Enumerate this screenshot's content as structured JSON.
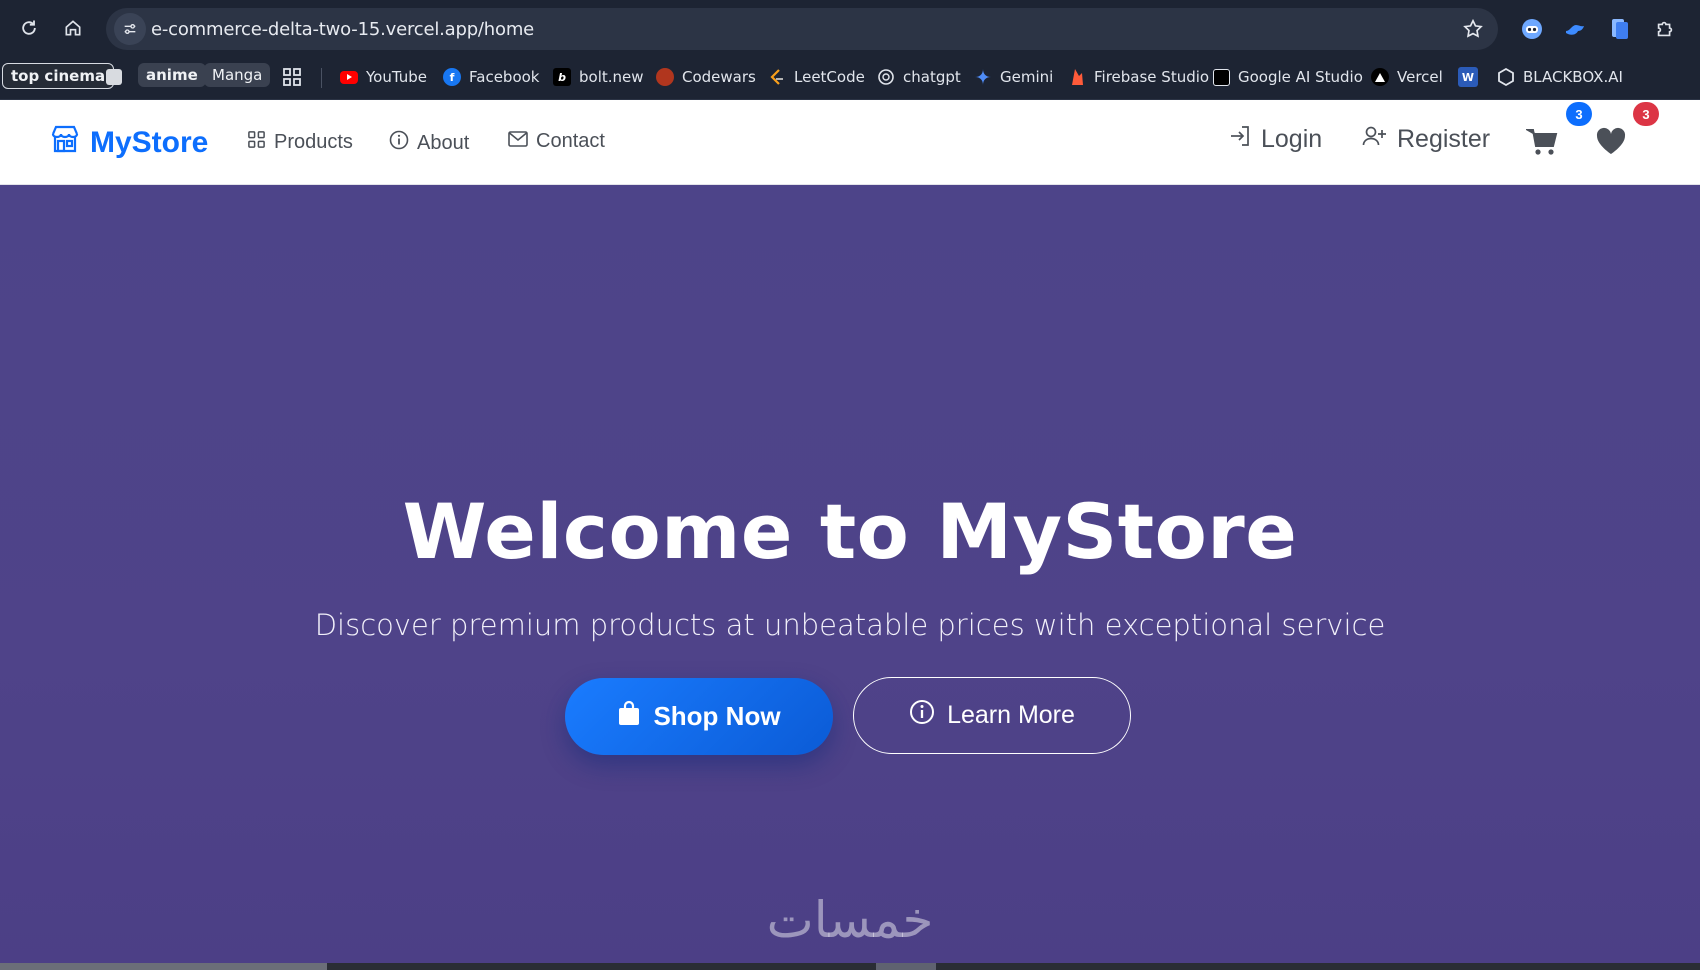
{
  "browser": {
    "url": "e-commerce-delta-two-15.vercel.app/home",
    "bookmarks": {
      "chips": [
        "top cinema",
        "anime",
        "Manga"
      ],
      "items": [
        "YouTube",
        "Facebook",
        "bolt.new",
        "Codewars",
        "LeetCode",
        "chatgpt",
        "Gemini",
        "Firebase Studio",
        "Google AI Studio",
        "Vercel",
        "BLACKBOX.AI"
      ]
    }
  },
  "site": {
    "brand": "MyStore",
    "nav": {
      "products": "Products",
      "about": "About",
      "contact": "Contact",
      "login": "Login",
      "register": "Register",
      "cart_count": "3",
      "wishlist_count": "3"
    },
    "hero": {
      "title": "Welcome to MyStore",
      "subtitle": "Discover premium products at unbeatable prices with exceptional service",
      "shop_button": "Shop Now",
      "learn_button": "Learn More"
    },
    "watermark": "خمسات"
  },
  "colors": {
    "brand": "#0d6efd",
    "hero_bg": "#4d4489",
    "cart_badge": "#0d6efd",
    "wishlist_badge": "#dc3545"
  }
}
